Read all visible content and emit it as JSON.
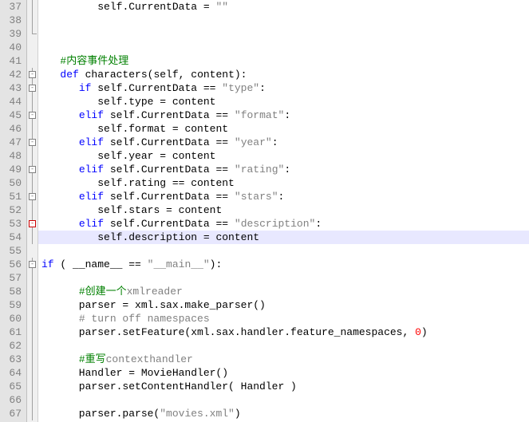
{
  "lines": [
    {
      "n": 37,
      "fold": "line",
      "tokens": [
        [
          "",
          ""
        ],
        [
          "",
          "         "
        ],
        [
          "self",
          "self"
        ],
        [
          "op",
          ".CurrentData = "
        ],
        [
          "str",
          "\"\""
        ]
      ]
    },
    {
      "n": 38,
      "fold": "line",
      "tokens": []
    },
    {
      "n": 39,
      "fold": "end",
      "tokens": []
    },
    {
      "n": 40,
      "fold": "none",
      "tokens": []
    },
    {
      "n": 41,
      "fold": "none",
      "tokens": [
        [
          "",
          "   "
        ],
        [
          "cmtGreen",
          "#内容事件处理"
        ]
      ]
    },
    {
      "n": 42,
      "fold": "box",
      "tokens": [
        [
          "",
          "   "
        ],
        [
          "kw",
          "def"
        ],
        [
          "",
          " "
        ],
        [
          "func",
          "characters"
        ],
        [
          "op",
          "("
        ],
        [
          "self",
          "self"
        ],
        [
          "op",
          ", content):"
        ]
      ]
    },
    {
      "n": 43,
      "fold": "box",
      "tokens": [
        [
          "",
          "      "
        ],
        [
          "kw",
          "if"
        ],
        [
          "",
          " "
        ],
        [
          "self",
          "self"
        ],
        [
          "op",
          ".CurrentData == "
        ],
        [
          "str",
          "\"type\""
        ],
        [
          "op",
          ":"
        ]
      ]
    },
    {
      "n": 44,
      "fold": "line",
      "tokens": [
        [
          "",
          "         "
        ],
        [
          "self",
          "self"
        ],
        [
          "op",
          ".type = content"
        ]
      ]
    },
    {
      "n": 45,
      "fold": "box",
      "tokens": [
        [
          "",
          "      "
        ],
        [
          "kw",
          "elif"
        ],
        [
          "",
          " "
        ],
        [
          "self",
          "self"
        ],
        [
          "op",
          ".CurrentData == "
        ],
        [
          "str",
          "\"format\""
        ],
        [
          "op",
          ":"
        ]
      ]
    },
    {
      "n": 46,
      "fold": "line",
      "tokens": [
        [
          "",
          "         "
        ],
        [
          "self",
          "self"
        ],
        [
          "op",
          ".format = content"
        ]
      ]
    },
    {
      "n": 47,
      "fold": "box",
      "tokens": [
        [
          "",
          "      "
        ],
        [
          "kw",
          "elif"
        ],
        [
          "",
          " "
        ],
        [
          "self",
          "self"
        ],
        [
          "op",
          ".CurrentData == "
        ],
        [
          "str",
          "\"year\""
        ],
        [
          "op",
          ":"
        ]
      ]
    },
    {
      "n": 48,
      "fold": "line",
      "tokens": [
        [
          "",
          "         "
        ],
        [
          "self",
          "self"
        ],
        [
          "op",
          ".year = content"
        ]
      ]
    },
    {
      "n": 49,
      "fold": "box",
      "tokens": [
        [
          "",
          "      "
        ],
        [
          "kw",
          "elif"
        ],
        [
          "",
          " "
        ],
        [
          "self",
          "self"
        ],
        [
          "op",
          ".CurrentData == "
        ],
        [
          "str",
          "\"rating\""
        ],
        [
          "op",
          ":"
        ]
      ]
    },
    {
      "n": 50,
      "fold": "line",
      "tokens": [
        [
          "",
          "         "
        ],
        [
          "self",
          "self"
        ],
        [
          "op",
          ".rating == content"
        ]
      ]
    },
    {
      "n": 51,
      "fold": "box",
      "tokens": [
        [
          "",
          "      "
        ],
        [
          "kw",
          "elif"
        ],
        [
          "",
          " "
        ],
        [
          "self",
          "self"
        ],
        [
          "op",
          ".CurrentData == "
        ],
        [
          "str",
          "\"stars\""
        ],
        [
          "op",
          ":"
        ]
      ]
    },
    {
      "n": 52,
      "fold": "line",
      "tokens": [
        [
          "",
          "         "
        ],
        [
          "self",
          "self"
        ],
        [
          "op",
          ".stars = content"
        ]
      ]
    },
    {
      "n": 53,
      "fold": "boxred",
      "tokens": [
        [
          "",
          "      "
        ],
        [
          "kw",
          "elif"
        ],
        [
          "",
          " "
        ],
        [
          "self",
          "self"
        ],
        [
          "op",
          ".CurrentData == "
        ],
        [
          "str",
          "\"description\""
        ],
        [
          "op",
          ":"
        ]
      ]
    },
    {
      "n": 54,
      "fold": "line",
      "highlight": true,
      "tokens": [
        [
          "",
          "         "
        ],
        [
          "self",
          "self"
        ],
        [
          "op",
          ".description = content"
        ]
      ]
    },
    {
      "n": 55,
      "fold": "none",
      "tokens": []
    },
    {
      "n": 56,
      "fold": "box",
      "tokens": [
        [
          "kw",
          "if"
        ],
        [
          "",
          " ( "
        ],
        [
          "func",
          "__name__"
        ],
        [
          "op",
          " == "
        ],
        [
          "str",
          "\"__main__\""
        ],
        [
          "op",
          "):"
        ]
      ]
    },
    {
      "n": 57,
      "fold": "line",
      "tokens": []
    },
    {
      "n": 58,
      "fold": "line",
      "tokens": [
        [
          "",
          "      "
        ],
        [
          "cmtGreen",
          "#创建一个"
        ],
        [
          "cmtGray",
          "xmlreader"
        ]
      ]
    },
    {
      "n": 59,
      "fold": "line",
      "tokens": [
        [
          "",
          "      parser = xml.sax.make_parser()"
        ]
      ]
    },
    {
      "n": 60,
      "fold": "line",
      "tokens": [
        [
          "",
          "      "
        ],
        [
          "cmtGray",
          "# turn off namespaces"
        ]
      ]
    },
    {
      "n": 61,
      "fold": "line",
      "tokens": [
        [
          "",
          "      parser.setFeature(xml.sax.handler.feature_namespaces, "
        ],
        [
          "num",
          "0"
        ],
        [
          "op",
          ")"
        ]
      ]
    },
    {
      "n": 62,
      "fold": "line",
      "tokens": []
    },
    {
      "n": 63,
      "fold": "line",
      "tokens": [
        [
          "",
          "      "
        ],
        [
          "cmtGreen",
          "#重写"
        ],
        [
          "cmtGray",
          "contexthandler"
        ]
      ]
    },
    {
      "n": 64,
      "fold": "line",
      "tokens": [
        [
          "",
          "      Handler = MovieHandler()"
        ]
      ]
    },
    {
      "n": 65,
      "fold": "line",
      "tokens": [
        [
          "",
          "      parser.setContentHandler( Handler )"
        ]
      ]
    },
    {
      "n": 66,
      "fold": "line",
      "tokens": []
    },
    {
      "n": 67,
      "fold": "line",
      "tokens": [
        [
          "",
          "      parser.parse("
        ],
        [
          "str",
          "\"movies.xml\""
        ],
        [
          "op",
          ")"
        ]
      ]
    }
  ]
}
